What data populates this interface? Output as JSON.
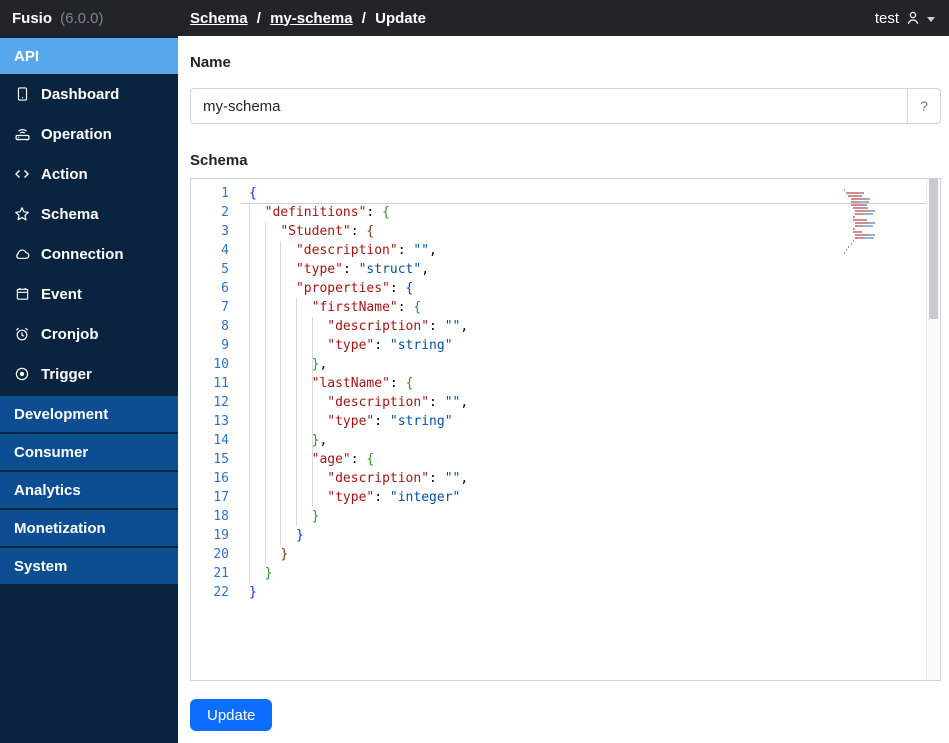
{
  "header": {
    "brand": "Fusio",
    "version": "(6.0.0)",
    "breadcrumb": [
      {
        "label": "Schema"
      },
      {
        "label": "my-schema"
      },
      {
        "label": "Update"
      }
    ],
    "separator": "/",
    "user": "test",
    "user_icon": "person-icon",
    "caret_icon": "chevron-down-icon"
  },
  "sidebar": {
    "active_group": "API",
    "items": [
      {
        "label": "Dashboard",
        "icon": "tablet-icon"
      },
      {
        "label": "Operation",
        "icon": "router-icon"
      },
      {
        "label": "Action",
        "icon": "code-icon"
      },
      {
        "label": "Schema",
        "icon": "star-icon"
      },
      {
        "label": "Connection",
        "icon": "cloud-icon"
      },
      {
        "label": "Event",
        "icon": "calendar-icon"
      },
      {
        "label": "Cronjob",
        "icon": "alarm-clock-icon"
      },
      {
        "label": "Trigger",
        "icon": "record-circle-icon"
      }
    ],
    "groups": [
      "Development",
      "Consumer",
      "Analytics",
      "Monetization",
      "System"
    ]
  },
  "form": {
    "name_label": "Name",
    "name_value": "my-schema",
    "help_button": "?",
    "schema_label": "Schema",
    "update_label": "Update"
  },
  "editor": {
    "language": "json",
    "colors": {
      "line_number": "#2f73c0",
      "key": "#a31515",
      "value": "#0451a5",
      "plain": "#000000",
      "bracket_level1": "#0431fa",
      "bracket_level2": "#319331",
      "bracket_level3": "#7b3814",
      "current_line_border": "#d0d0d0"
    },
    "lines": [
      [
        [
          "{",
          "b1"
        ]
      ],
      [
        [
          "  ",
          "p"
        ],
        [
          "\"definitions\"",
          "k"
        ],
        [
          ": ",
          "p"
        ],
        [
          "{",
          "b2"
        ]
      ],
      [
        [
          "    ",
          "p"
        ],
        [
          "\"Student\"",
          "k"
        ],
        [
          ": ",
          "p"
        ],
        [
          "{",
          "b3"
        ]
      ],
      [
        [
          "      ",
          "p"
        ],
        [
          "\"description\"",
          "k"
        ],
        [
          ": ",
          "p"
        ],
        [
          "\"\"",
          "v"
        ],
        [
          ",",
          "p"
        ]
      ],
      [
        [
          "      ",
          "p"
        ],
        [
          "\"type\"",
          "k"
        ],
        [
          ": ",
          "p"
        ],
        [
          "\"struct\"",
          "v"
        ],
        [
          ",",
          "p"
        ]
      ],
      [
        [
          "      ",
          "p"
        ],
        [
          "\"properties\"",
          "k"
        ],
        [
          ": ",
          "p"
        ],
        [
          "{",
          "b1"
        ]
      ],
      [
        [
          "        ",
          "p"
        ],
        [
          "\"firstName\"",
          "k"
        ],
        [
          ": ",
          "p"
        ],
        [
          "{",
          "b2"
        ]
      ],
      [
        [
          "          ",
          "p"
        ],
        [
          "\"description\"",
          "k"
        ],
        [
          ": ",
          "p"
        ],
        [
          "\"\"",
          "v"
        ],
        [
          ",",
          "p"
        ]
      ],
      [
        [
          "          ",
          "p"
        ],
        [
          "\"type\"",
          "k"
        ],
        [
          ": ",
          "p"
        ],
        [
          "\"string\"",
          "v"
        ]
      ],
      [
        [
          "        ",
          "p"
        ],
        [
          "}",
          "b2"
        ],
        [
          ",",
          "p"
        ]
      ],
      [
        [
          "        ",
          "p"
        ],
        [
          "\"lastName\"",
          "k"
        ],
        [
          ": ",
          "p"
        ],
        [
          "{",
          "b2"
        ]
      ],
      [
        [
          "          ",
          "p"
        ],
        [
          "\"description\"",
          "k"
        ],
        [
          ": ",
          "p"
        ],
        [
          "\"\"",
          "v"
        ],
        [
          ",",
          "p"
        ]
      ],
      [
        [
          "          ",
          "p"
        ],
        [
          "\"type\"",
          "k"
        ],
        [
          ": ",
          "p"
        ],
        [
          "\"string\"",
          "v"
        ]
      ],
      [
        [
          "        ",
          "p"
        ],
        [
          "}",
          "b2"
        ],
        [
          ",",
          "p"
        ]
      ],
      [
        [
          "        ",
          "p"
        ],
        [
          "\"age\"",
          "k"
        ],
        [
          ": ",
          "p"
        ],
        [
          "{",
          "b2"
        ]
      ],
      [
        [
          "          ",
          "p"
        ],
        [
          "\"description\"",
          "k"
        ],
        [
          ": ",
          "p"
        ],
        [
          "\"\"",
          "v"
        ],
        [
          ",",
          "p"
        ]
      ],
      [
        [
          "          ",
          "p"
        ],
        [
          "\"type\"",
          "k"
        ],
        [
          ": ",
          "p"
        ],
        [
          "\"integer\"",
          "v"
        ]
      ],
      [
        [
          "        ",
          "p"
        ],
        [
          "}",
          "b2"
        ]
      ],
      [
        [
          "      ",
          "p"
        ],
        [
          "}",
          "b1"
        ]
      ],
      [
        [
          "    ",
          "p"
        ],
        [
          "}",
          "b3"
        ]
      ],
      [
        [
          "  ",
          "p"
        ],
        [
          "}",
          "b2"
        ]
      ],
      [
        [
          "}",
          "b1"
        ]
      ]
    ]
  },
  "colors": {
    "header_bg": "#212529",
    "sidebar_bg": "#0a2440",
    "sidebar_active_bg": "#55a9ea",
    "sidebar_group_bg": "#0d4d91",
    "primary": "#0d6efd",
    "input_border": "#ced4da"
  }
}
